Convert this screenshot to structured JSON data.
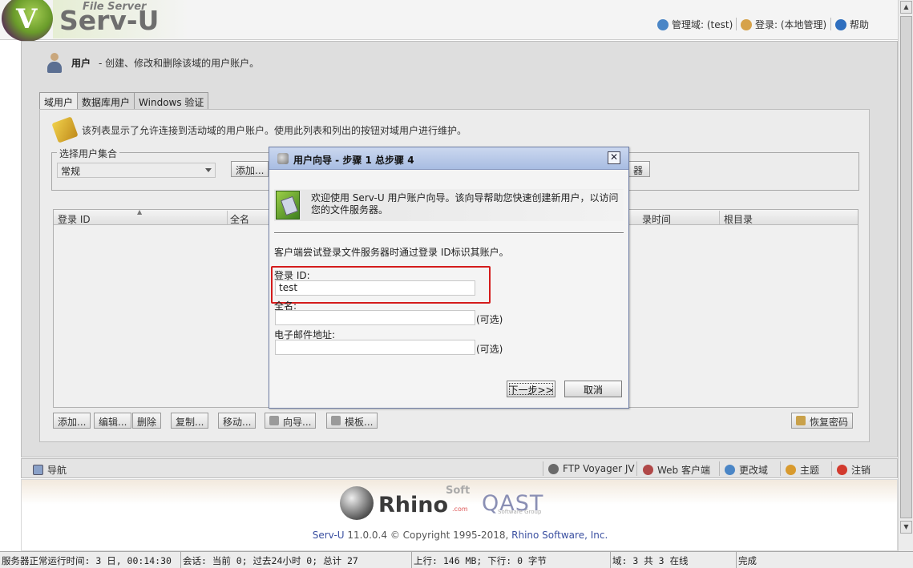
{
  "header": {
    "brand_top": "File Server",
    "brand_main": "Serv-U",
    "brand_v": "V",
    "manage_domain": "管理域: (test)",
    "login": "登录: (本地管理)",
    "help": "帮助"
  },
  "page": {
    "title": "用户",
    "description": "- 创建、修改和删除该域的用户账户。"
  },
  "tabs": [
    {
      "label": "域用户",
      "active": true
    },
    {
      "label": "数据库用户",
      "active": false
    },
    {
      "label": "Windows 验证",
      "active": false
    }
  ],
  "panel": {
    "info": "该列表显示了允许连接到活动域的用户账户。使用此列表和列出的按钮对域用户进行维护。",
    "group_legend": "选择用户集合",
    "group_value": "常规",
    "group_add_btn": "添加...",
    "group_right_btn": "器"
  },
  "table": {
    "columns": [
      "登录 ID",
      "全名",
      "录时间",
      "根目录"
    ]
  },
  "actions": {
    "add": "添加...",
    "edit": "编辑...",
    "delete": "删除",
    "copy": "复制...",
    "move": "移动...",
    "wizard": "向导...",
    "template": "模板...",
    "recover": "恢复密码"
  },
  "navbar": {
    "nav": "导航",
    "ftp_voyager": "FTP Voyager JV",
    "web_client": "Web 客户端",
    "change_domain": "更改域",
    "theme": "主题",
    "logout": "注销"
  },
  "footer": {
    "rhino": "Rhino",
    "soft": "Soft",
    "com": ".com",
    "qast": "QAST",
    "qast_sub": "Software Group",
    "copyright_product": "Serv-U",
    "copyright_text": "11.0.0.4 © Copyright 1995-2018,",
    "copyright_company": "Rhino Software, Inc."
  },
  "statusbar": {
    "uptime": "服务器正常运行时间: 3 日, 00:14:30",
    "sessions": "会话: 当前 0; 过去24小时 0; 总计 27",
    "traffic": "上行: 146 MB; 下行: 0 字节",
    "domains": "域: 3 共 3 在线",
    "state": "完成"
  },
  "dialog": {
    "title": "用户向导 - 步骤 1 总步骤 4",
    "close": "✕",
    "banner": "欢迎使用 Serv-U 用户账户向导。该向导帮助您快速创建新用户，以访问您的文件服务器。",
    "intro": "客户端尝试登录文件服务器时通过登录 ID标识其账户。",
    "login_label": "登录 ID:",
    "login_value": "test",
    "fullname_label": "全名:",
    "fullname_value": "",
    "fullname_opt": "(可选)",
    "email_label": "电子邮件地址:",
    "email_value": "",
    "email_opt": "(可选)",
    "next": "下一步>>",
    "cancel": "取消"
  },
  "colors": {
    "highlight": "#d41c1c",
    "dialog_title": "#a8bde2",
    "link": "#3a4fa0"
  }
}
